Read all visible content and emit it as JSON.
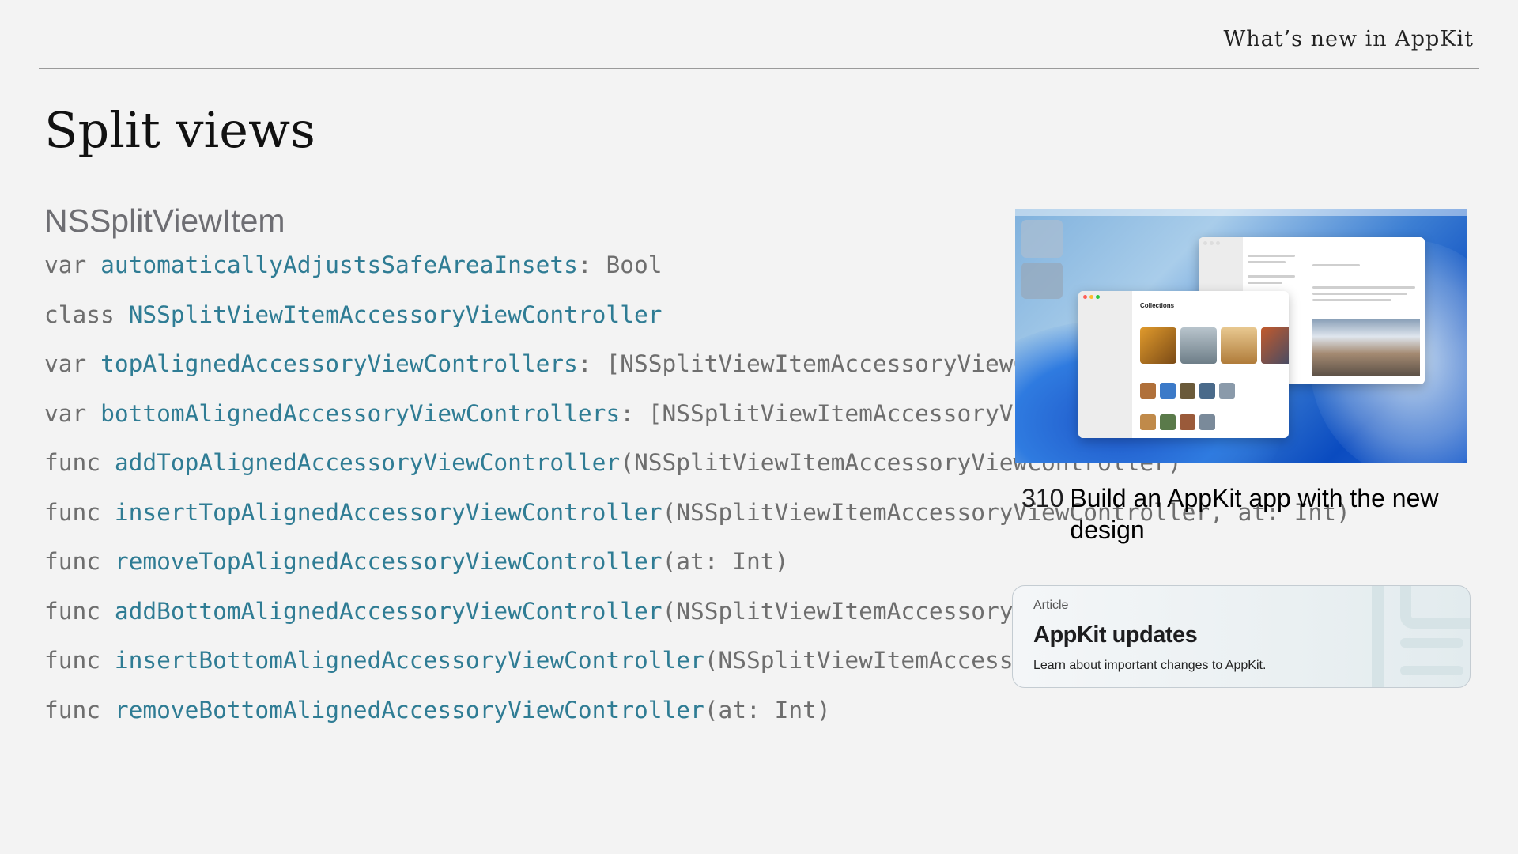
{
  "header": {
    "title": "What’s new in AppKit"
  },
  "page_title": "Split views",
  "section_heading": "NSSplitViewItem",
  "code_lines": [
    {
      "keyword": "var",
      "symbol": "automaticallyAdjustsSafeAreaInsets",
      "rest": ": Bool"
    },
    {
      "keyword": "class",
      "symbol": "NSSplitViewItemAccessoryViewController",
      "rest": ""
    },
    {
      "keyword": "var",
      "symbol": "topAlignedAccessoryViewControllers",
      "rest": ": [NSSplitViewItemAccessoryViewController]"
    },
    {
      "keyword": "var",
      "symbol": "bottomAlignedAccessoryViewControllers",
      "rest": ": [NSSplitViewItemAccessoryViewController]"
    },
    {
      "keyword": "func",
      "symbol": "addTopAlignedAccessoryViewController",
      "rest": "(NSSplitViewItemAccessoryViewController)"
    },
    {
      "keyword": "func",
      "symbol": "insertTopAlignedAccessoryViewController",
      "rest": "(NSSplitViewItemAccessoryViewController, at: Int)"
    },
    {
      "keyword": "func",
      "symbol": "removeTopAlignedAccessoryViewController",
      "rest": "(at: Int)"
    },
    {
      "keyword": "func",
      "symbol": "addBottomAlignedAccessoryViewController",
      "rest": "(NSSplitViewItemAccessoryViewController)"
    },
    {
      "keyword": "func",
      "symbol": "insertBottomAlignedAccessoryViewController",
      "rest": "(NSSplitViewItemAccessoryViewController, at: Int)"
    },
    {
      "keyword": "func",
      "symbol": "removeBottomAlignedAccessoryViewController",
      "rest": "(at: Int)"
    }
  ],
  "video_card": {
    "session_number": "310",
    "session_title": "Build an AppKit app with the new design",
    "thumbnail_window_title": "Collections"
  },
  "article_card": {
    "kind": "Article",
    "title": "AppKit updates",
    "description": "Learn about important changes to AppKit."
  },
  "colors": {
    "background": "#f3f3f3",
    "code_symbol": "#2f7c94",
    "code_plain": "#6e6e6e"
  }
}
